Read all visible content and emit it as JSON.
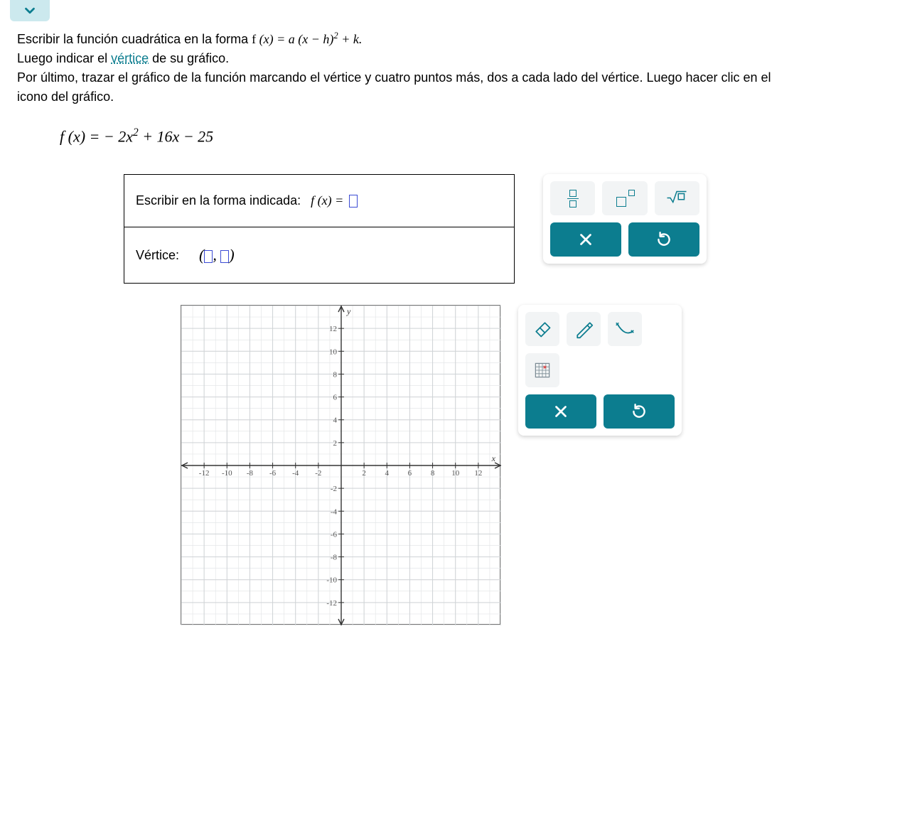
{
  "instructions": {
    "line1_pre": "Escribir la función cuadrática en la forma ",
    "line1_formula": "f (x) = a (x − h)² + k.",
    "line2_pre": "Luego indicar el ",
    "line2_link": "vértice",
    "line2_post": " de su gráfico.",
    "line3": "Por último, trazar el gráfico de la función marcando el vértice y cuatro puntos más, dos a cada lado del vértice. Luego hacer clic en el icono del gráfico."
  },
  "equation": "f (x) = − 2x² + 16x − 25",
  "answer": {
    "prompt": "Escribir  en  la  forma  indicada:",
    "fx_label": "f (x) = ",
    "vertex_label": "Vértice:"
  },
  "tools": {
    "fraction": "fraction",
    "exponent": "exponent",
    "sqrt": "square-root",
    "clear": "clear",
    "reset": "reset"
  },
  "graph_tools": {
    "eraser": "eraser",
    "pencil": "pencil",
    "curve": "curve",
    "grid": "grid-point",
    "clear": "clear",
    "reset": "reset"
  },
  "chart_data": {
    "type": "scatter",
    "title": "",
    "xlabel": "x",
    "ylabel": "y",
    "xlim": [
      -14,
      14
    ],
    "ylim": [
      -14,
      14
    ],
    "xticks": [
      -12,
      -10,
      -8,
      -6,
      -4,
      -2,
      2,
      4,
      6,
      8,
      10,
      12
    ],
    "yticks": [
      -12,
      -10,
      -8,
      -6,
      -4,
      -2,
      2,
      4,
      6,
      8,
      10,
      12
    ],
    "grid": true,
    "series": []
  }
}
